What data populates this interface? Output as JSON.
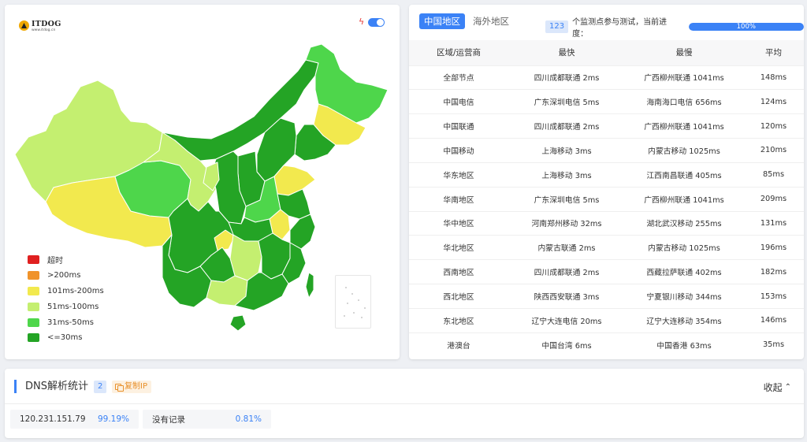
{
  "map_panel": {
    "logo": {
      "name": "ITDOG",
      "sub": "www.itdog.cn"
    },
    "legend": [
      {
        "label": "超时",
        "color": "#e02020"
      },
      {
        "label": ">200ms",
        "color": "#f0932b"
      },
      {
        "label": "101ms-200ms",
        "color": "#f2e94e"
      },
      {
        "label": "51ms-100ms",
        "color": "#c4ef70"
      },
      {
        "label": "31ms-50ms",
        "color": "#4ed64b"
      },
      {
        "label": "<=30ms",
        "color": "#24a425"
      }
    ]
  },
  "table_panel": {
    "tabs": [
      {
        "label": "中国地区",
        "active": true
      },
      {
        "label": "海外地区",
        "active": false
      }
    ],
    "probe_count": "123",
    "progress_text": "个监测点参与测试，当前进度：",
    "progress_percent": 100,
    "progress_label": "100%",
    "columns": [
      "区域/运营商",
      "最快",
      "最慢",
      "平均"
    ],
    "rows": [
      [
        "全部节点",
        "四川成都联通 2ms",
        "广西柳州联通 1041ms",
        "148ms"
      ],
      [
        "中国电信",
        "广东深圳电信 5ms",
        "海南海口电信 656ms",
        "124ms"
      ],
      [
        "中国联通",
        "四川成都联通 2ms",
        "广西柳州联通 1041ms",
        "120ms"
      ],
      [
        "中国移动",
        "上海移动 3ms",
        "内蒙古移动 1025ms",
        "210ms"
      ],
      [
        "华东地区",
        "上海移动 3ms",
        "江西南昌联通 405ms",
        "85ms"
      ],
      [
        "华南地区",
        "广东深圳电信 5ms",
        "广西柳州联通 1041ms",
        "209ms"
      ],
      [
        "华中地区",
        "河南郑州移动 32ms",
        "湖北武汉移动 255ms",
        "131ms"
      ],
      [
        "华北地区",
        "内蒙古联通 2ms",
        "内蒙古移动 1025ms",
        "196ms"
      ],
      [
        "西南地区",
        "四川成都联通 2ms",
        "西藏拉萨联通 402ms",
        "182ms"
      ],
      [
        "西北地区",
        "陕西西安联通 3ms",
        "宁夏银川移动 344ms",
        "153ms"
      ],
      [
        "东北地区",
        "辽宁大连电信 20ms",
        "辽宁大连移动 354ms",
        "146ms"
      ],
      [
        "港澳台",
        "中国台湾 6ms",
        "中国香港 63ms",
        "35ms"
      ]
    ]
  },
  "dns_panel": {
    "title": "DNS解析统计",
    "count": "2",
    "copy_label": "复制IP",
    "collapse_label": "收起",
    "items": [
      {
        "ip": "120.231.151.79",
        "percent": "99.19%"
      },
      {
        "ip": "没有记录",
        "percent": "0.81%"
      }
    ]
  },
  "colors": {
    "accent": "#3b82f6"
  }
}
